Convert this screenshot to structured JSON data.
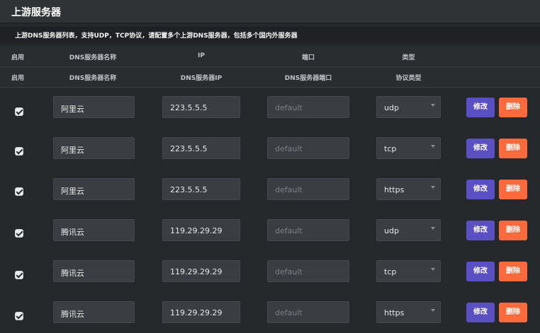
{
  "page": {
    "title": "上游服务器"
  },
  "description": "上游DNS服务器列表，支持UDP，TCP协议，请配置多个上游DNS服务器，包括多个国内外服务器",
  "header1": {
    "enabled": "启用",
    "name": "DNS服务器名称",
    "ip": "IP",
    "port": "端口",
    "type": "类型"
  },
  "header2": {
    "enabled": "启用",
    "name": "DNS服务器名称",
    "ip": "DNS服务器IP",
    "port": "DNS服务器端口",
    "type": "协议类型"
  },
  "rows": [
    {
      "enabled": true,
      "name": "阿里云",
      "ip": "223.5.5.5",
      "port_placeholder": "default",
      "type": "udp",
      "edit": "修改",
      "delete": "删除"
    },
    {
      "enabled": true,
      "name": "阿里云",
      "ip": "223.5.5.5",
      "port_placeholder": "default",
      "type": "tcp",
      "edit": "修改",
      "delete": "删除"
    },
    {
      "enabled": true,
      "name": "阿里云",
      "ip": "223.5.5.5",
      "port_placeholder": "default",
      "type": "https",
      "edit": "修改",
      "delete": "删除"
    },
    {
      "enabled": true,
      "name": "腾讯云",
      "ip": "119.29.29.29",
      "port_placeholder": "default",
      "type": "udp",
      "edit": "修改",
      "delete": "删除"
    },
    {
      "enabled": true,
      "name": "腾讯云",
      "ip": "119.29.29.29",
      "port_placeholder": "default",
      "type": "tcp",
      "edit": "修改",
      "delete": "删除"
    },
    {
      "enabled": true,
      "name": "腾讯云",
      "ip": "119.29.29.29",
      "port_placeholder": "default",
      "type": "https",
      "edit": "修改",
      "delete": "删除"
    }
  ],
  "colors": {
    "edit_button": "#5b4fc4",
    "delete_button": "#ff6a3d",
    "background": "#26292c"
  }
}
